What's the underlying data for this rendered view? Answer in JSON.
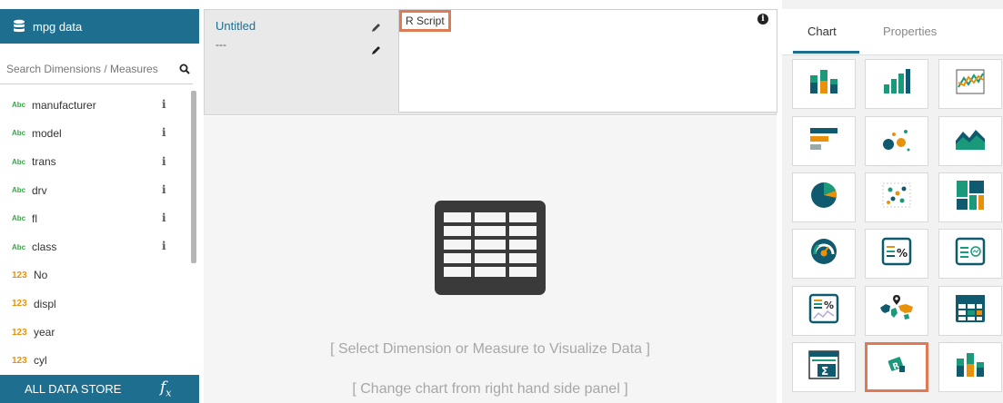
{
  "datasource": {
    "name": "mpg data"
  },
  "search": {
    "placeholder": "Search Dimensions / Measures"
  },
  "fields": [
    {
      "type": "Abc",
      "name": "manufacturer",
      "info": "i"
    },
    {
      "type": "Abc",
      "name": "model",
      "info": "i"
    },
    {
      "type": "Abc",
      "name": "trans",
      "info": "i"
    },
    {
      "type": "Abc",
      "name": "drv",
      "info": "i"
    },
    {
      "type": "Abc",
      "name": "fl",
      "info": "i"
    },
    {
      "type": "Abc",
      "name": "class",
      "info": "i"
    },
    {
      "type": "123",
      "name": "No",
      "info": ""
    },
    {
      "type": "123",
      "name": "displ",
      "info": ""
    },
    {
      "type": "123",
      "name": "year",
      "info": ""
    },
    {
      "type": "123",
      "name": "cyl",
      "info": ""
    }
  ],
  "footer": {
    "label": "ALL DATA STORE",
    "fx": "f",
    "fx_sub": "x"
  },
  "chart": {
    "title": "Untitled",
    "subtitle": "---"
  },
  "script": {
    "label": "R Script",
    "info": "i"
  },
  "canvas": {
    "message1": "[ Select Dimension or Measure to Visualize Data ]",
    "message2": "[ Change chart from right hand side panel ]"
  },
  "right_tabs": {
    "chart": "Chart",
    "properties": "Properties",
    "active": "chart"
  },
  "chart_types": [
    "colored-bar-icon",
    "bar-chart-icon",
    "line-chart-icon",
    "horizontal-bar-icon",
    "bubble-chart-icon",
    "area-chart-icon",
    "pie-chart-icon",
    "scatter-plot-icon",
    "treemap-icon",
    "gauge-icon",
    "kpi-percent-icon",
    "kpi-trend-icon",
    "kpi-percent-line-icon",
    "geo-map-icon",
    "data-grid-icon",
    "pivot-sum-icon",
    "r-script-icon",
    "colored-bar-icon"
  ],
  "selected_chart_type": "r-script-icon",
  "colors": {
    "brand": "#1e6f8f",
    "highlight": "#e07a56",
    "dimension": "#3aa54a",
    "measure": "#e8920c"
  }
}
